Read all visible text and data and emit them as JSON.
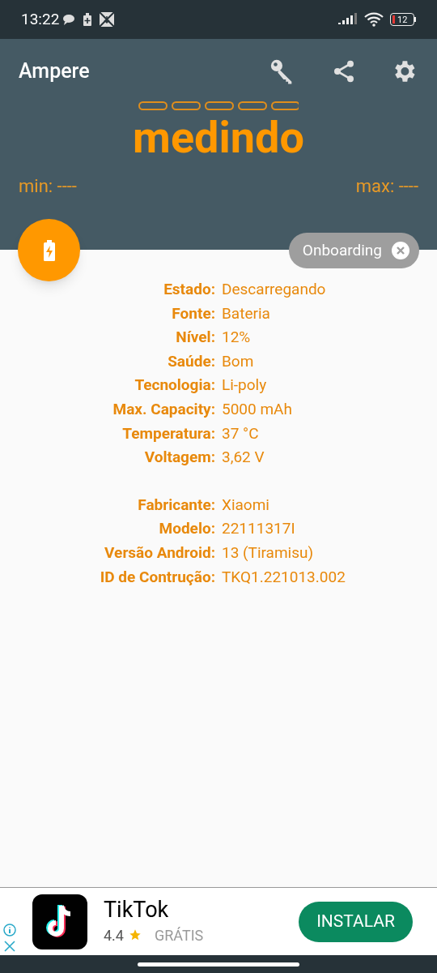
{
  "status_bar": {
    "time": "13:22",
    "battery": "12"
  },
  "app_bar": {
    "title": "Ampere"
  },
  "meter": {
    "reading": "medindo",
    "min": "min: ----",
    "max": "max: ----"
  },
  "chip": {
    "label": "Onboarding"
  },
  "info_groups": [
    [
      {
        "label": "Estado:",
        "value": "Descarregando"
      },
      {
        "label": "Fonte:",
        "value": "Bateria"
      },
      {
        "label": "Nível:",
        "value": "12%"
      },
      {
        "label": "Saúde:",
        "value": "Bom"
      },
      {
        "label": "Tecnologia:",
        "value": "Li-poly"
      },
      {
        "label": "Max. Capacity:",
        "value": "5000 mAh"
      },
      {
        "label": "Temperatura:",
        "value": "37 °C"
      },
      {
        "label": "Voltagem:",
        "value": "3,62 V"
      }
    ],
    [
      {
        "label": "Fabricante:",
        "value": "Xiaomi"
      },
      {
        "label": "Modelo:",
        "value": "22111317I"
      },
      {
        "label": "Versão Android:",
        "value": "13 (Tiramisu)"
      },
      {
        "label": "ID de Contrução:",
        "value": "TKQ1.221013.002"
      }
    ]
  ],
  "ad": {
    "title": "TikTok",
    "rating": "4.4",
    "price": "GRÁTIS",
    "button": "INSTALAR"
  }
}
